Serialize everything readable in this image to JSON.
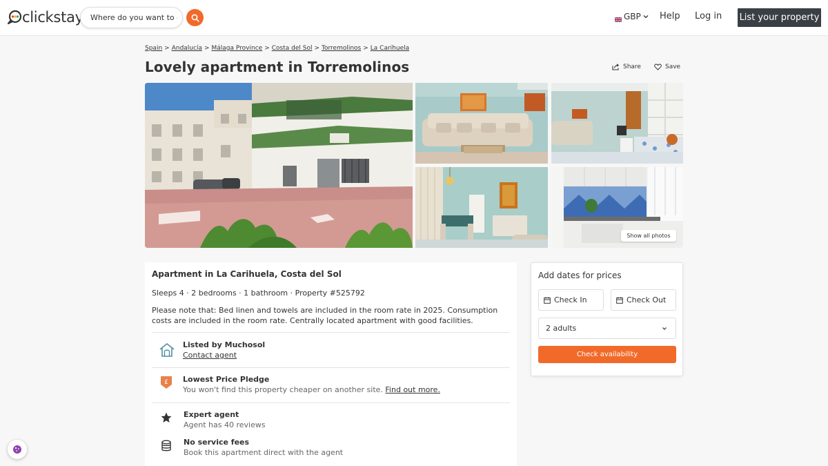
{
  "header": {
    "logo_text": "clickstay",
    "search_placeholder": "Where do you want to go?",
    "currency": "GBP",
    "help": "Help",
    "login": "Log in",
    "list_property": "List your property"
  },
  "breadcrumb": [
    "Spain",
    "Andalucía",
    "Málaga Province",
    "Costa del Sol",
    "Torremolinos",
    "La Carihuela"
  ],
  "breadcrumb_separator": ">",
  "title": "Lovely apartment in Torremolinos",
  "actions": {
    "share": "Share",
    "save": "Save"
  },
  "gallery": {
    "show_all": "Show all photos"
  },
  "details": {
    "heading": "Apartment in La Carihuela, Costa del Sol",
    "specs": "Sleeps 4 · 2 bedrooms · 1 bathroom · Property #525792",
    "description": "Please note that: Bed linen and towels are included in the room rate in 2025. Consumption costs are included in the room rate. Centrally located apartment with good facilities.",
    "features": [
      {
        "title": "Listed by Muchosol",
        "sub": "Contact agent"
      },
      {
        "title": "Lowest Price Pledge",
        "sub": "You won't find this property cheaper on another site.",
        "link": "Find out more."
      },
      {
        "title": "Expert agent",
        "sub": "Agent has 40 reviews"
      },
      {
        "title": "No service fees",
        "sub": "Book this apartment direct with the agent"
      }
    ]
  },
  "booking": {
    "heading": "Add dates for prices",
    "check_in": "Check In",
    "check_out": "Check Out",
    "guests": "2 adults",
    "button": "Check availability"
  },
  "colors": {
    "accent": "#f26a2a",
    "dark_button": "#3a3f45",
    "text": "#333333"
  }
}
